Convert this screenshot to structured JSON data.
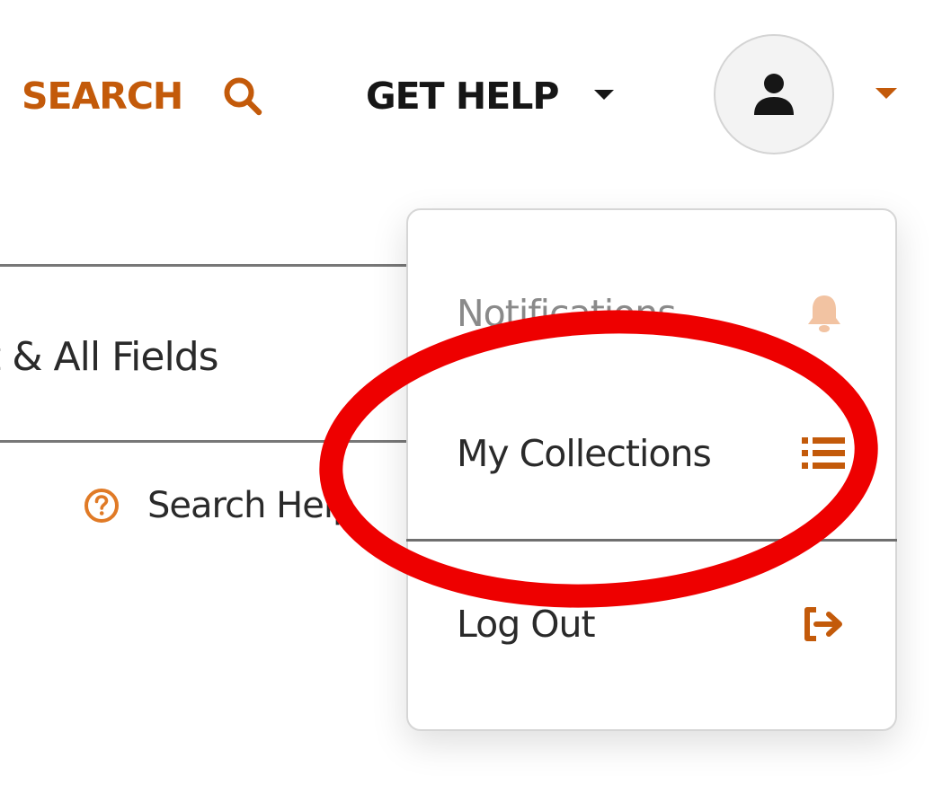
{
  "nav": {
    "search_label": "SEARCH",
    "help_label": "GET HELP"
  },
  "search": {
    "field_label": "t & All Fields",
    "help_link": "Search Help"
  },
  "account_menu": {
    "items": [
      {
        "label": "Notifications",
        "icon": "bell-icon"
      },
      {
        "label": "My Collections",
        "icon": "list-icon"
      },
      {
        "label": "Log Out",
        "icon": "sign-out-icon"
      }
    ]
  },
  "colors": {
    "accent": "#c35a0a",
    "annotation": "#ee0000",
    "text": "#2a2a2a"
  }
}
